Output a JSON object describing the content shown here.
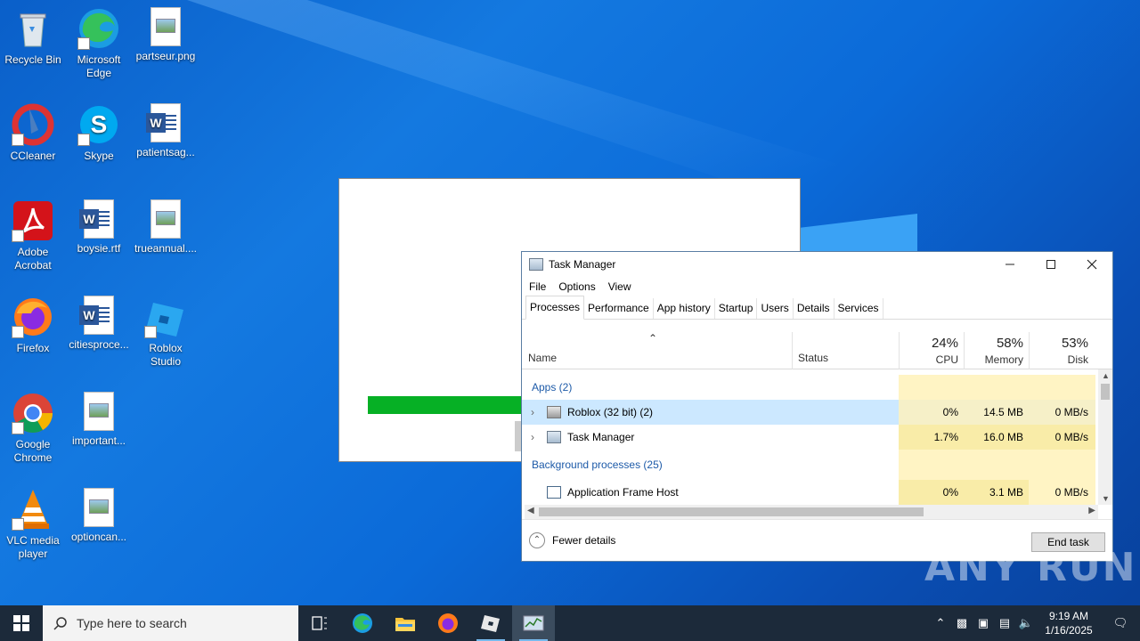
{
  "desktop": {
    "icons": [
      {
        "label": "Recycle Bin",
        "icon": "recycle-bin-icon"
      },
      {
        "label": "Microsoft Edge",
        "icon": "edge-icon"
      },
      {
        "label": "partseur.png",
        "icon": "image-file-icon"
      },
      {
        "label": "CCleaner",
        "icon": "ccleaner-icon"
      },
      {
        "label": "Skype",
        "icon": "skype-icon"
      },
      {
        "label": "patientsag...",
        "icon": "word-doc-icon"
      },
      {
        "label": "Adobe Acrobat",
        "icon": "acrobat-icon"
      },
      {
        "label": "boysie.rtf",
        "icon": "word-doc-icon"
      },
      {
        "label": "trueannual....",
        "icon": "image-file-icon"
      },
      {
        "label": "Firefox",
        "icon": "firefox-icon"
      },
      {
        "label": "citiesproce...",
        "icon": "word-doc-icon"
      },
      {
        "label": "Roblox Studio",
        "icon": "roblox-studio-icon"
      },
      {
        "label": "Google Chrome",
        "icon": "chrome-icon"
      },
      {
        "label": "important...",
        "icon": "image-file-icon"
      },
      {
        "label": "VLC media player",
        "icon": "vlc-icon"
      },
      {
        "label": "optioncan...",
        "icon": "image-file-icon"
      }
    ]
  },
  "splash": {
    "progress": 0.42,
    "progress_color": "#06b025"
  },
  "task_manager": {
    "title": "Task Manager",
    "menu": [
      "File",
      "Options",
      "View"
    ],
    "tabs": [
      "Processes",
      "Performance",
      "App history",
      "Startup",
      "Users",
      "Details",
      "Services"
    ],
    "active_tab": "Processes",
    "columns": {
      "name": "Name",
      "status": "Status",
      "cpu": {
        "pct": "24%",
        "label": "CPU"
      },
      "memory": {
        "pct": "58%",
        "label": "Memory"
      },
      "disk": {
        "pct": "53%",
        "label": "Disk"
      }
    },
    "groups": {
      "apps": "Apps (2)",
      "background": "Background processes (25)"
    },
    "rows": [
      {
        "name": "Roblox (32 bit) (2)",
        "cpu": "0%",
        "memory": "14.5 MB",
        "disk": "0 MB/s"
      },
      {
        "name": "Task Manager",
        "cpu": "1.7%",
        "memory": "16.0 MB",
        "disk": "0 MB/s"
      },
      {
        "name": "Application Frame Host",
        "cpu": "0%",
        "memory": "3.1 MB",
        "disk": "0 MB/s"
      }
    ],
    "fewer_details": "Fewer details",
    "end_task": "End task"
  },
  "taskbar": {
    "search_placeholder": "Type here to search",
    "time": "9:19 AM",
    "date": "1/16/2025"
  },
  "watermark": "ANY RUN"
}
